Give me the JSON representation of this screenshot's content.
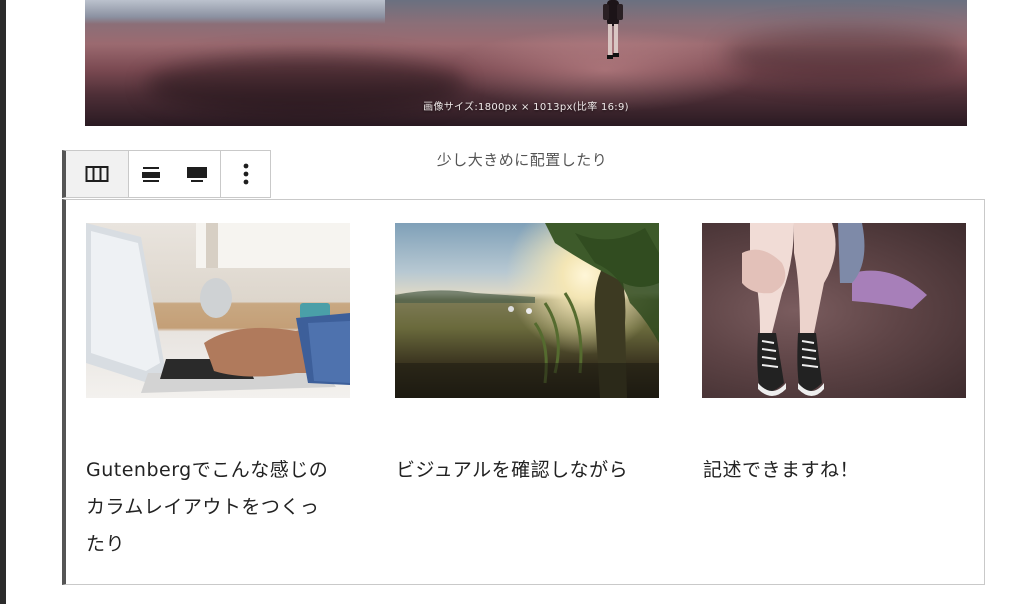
{
  "hero": {
    "image_alt": "person walking on beach at sunset",
    "size_caption": "画像サイズ:1800px × 1013px(比率 16:9)"
  },
  "image_caption": "少し大きめに配置したり",
  "toolbar": {
    "buttons": [
      {
        "name": "columns",
        "icon": "columns-icon"
      },
      {
        "name": "align-wide",
        "icon": "align-wide-icon"
      },
      {
        "name": "align-full",
        "icon": "align-full-icon"
      },
      {
        "name": "more-options",
        "icon": "vertical-ellipsis-icon"
      }
    ]
  },
  "columns": [
    {
      "image": "laptop typing",
      "text_line1": "Gutenbergでこんな感じの",
      "text_line2": "カラムレイアウトをつくっ",
      "text_line3": "たり"
    },
    {
      "image": "sunlit field with tree",
      "text_line1": "ビジュアルを確認しながら"
    },
    {
      "image": "legs with sneakers on rock",
      "text_line1": "記述できますね！"
    }
  ],
  "colors": {
    "block_border": "#c9c9c9",
    "selected_bar": "#555555",
    "toolbar_active_bg": "#f1f1f1"
  }
}
